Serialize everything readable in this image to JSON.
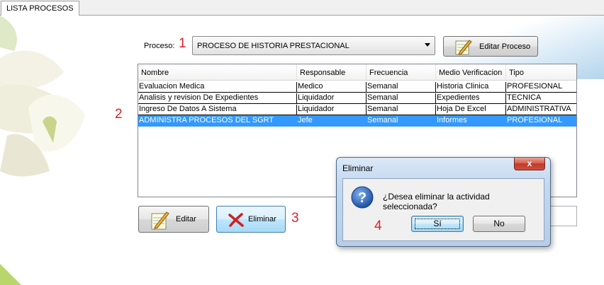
{
  "tab": {
    "label": "LISTA PROCESOS"
  },
  "proceso": {
    "label": "Proceso:",
    "selected": "PROCESO DE HISTORIA PRESTACIONAL"
  },
  "buttons": {
    "editar_proceso": "Editar Proceso",
    "editar": "Editar",
    "eliminar": "Eliminar"
  },
  "grid": {
    "columns": [
      "Nombre",
      "Responsable",
      "Frecuencia",
      "Medio Verificacion",
      "Tipo"
    ],
    "rows": [
      [
        "Evaluacion Medica",
        "Medico",
        "Semanal",
        "Historia Clinica",
        "PROFESIONAL"
      ],
      [
        "Analisis y revision De Expedientes",
        "Liquidador",
        "Semanal",
        "Expedientes",
        "TECNICA"
      ],
      [
        "Ingreso De Datos A Sistema",
        "Liquidador",
        "Semanal",
        "Hoja De Excel",
        "ADMINISTRATIVA"
      ],
      [
        "ADMINISTRA PROCESOS DEL SGRT",
        "Jefe",
        "Semanal",
        "Informes",
        "PROFESIONAL"
      ]
    ],
    "selected_row": 3
  },
  "annotations": {
    "a1": "1",
    "a2": "2",
    "a3": "3",
    "a4": "4"
  },
  "dialog": {
    "title": "Eliminar",
    "close": "x",
    "message": "¿Desea eliminar la actividad seleccionada?",
    "yes": "Sí",
    "no": "No",
    "icon": "question-icon"
  },
  "colors": {
    "selection": "#3399ff",
    "annotation": "#e0202a",
    "dialog_frame": "#c4d8ef",
    "close_button": "#c2382a"
  }
}
